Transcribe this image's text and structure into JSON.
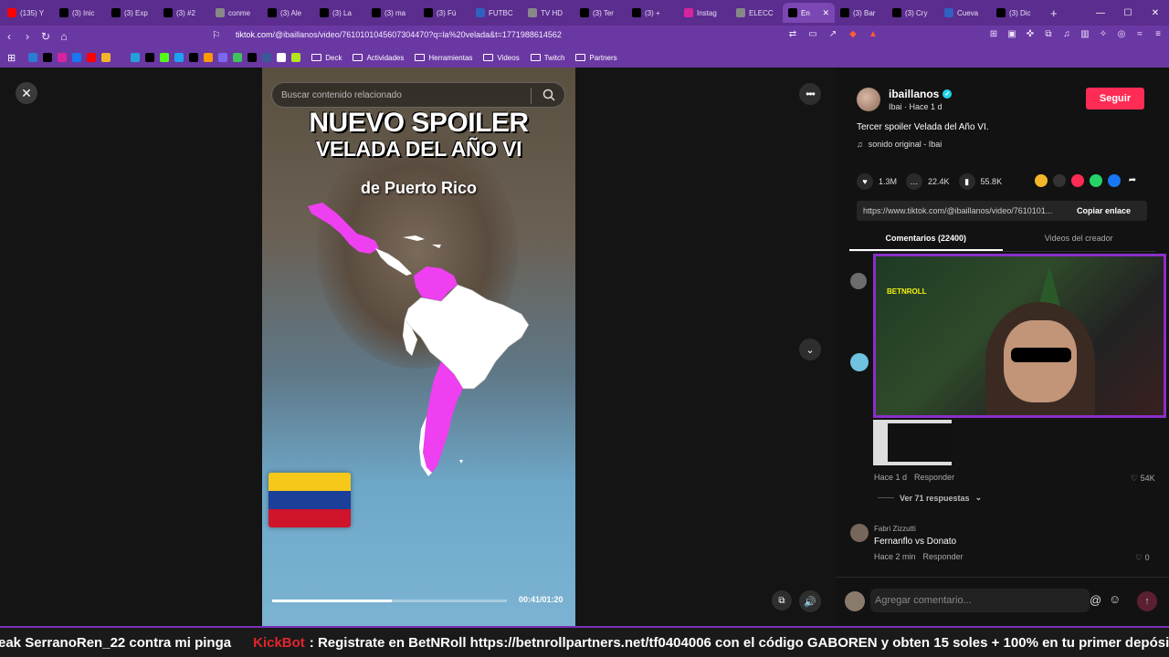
{
  "browser": {
    "tabs": [
      {
        "label": "(135) Y",
        "icon": "youtube-icon",
        "color": "#ff0000"
      },
      {
        "label": "(3) Inic",
        "icon": "x-icon",
        "color": "#000000"
      },
      {
        "label": "(3) Exp",
        "icon": "x-icon",
        "color": "#000000"
      },
      {
        "label": "(3) #2",
        "icon": "x-icon",
        "color": "#000000"
      },
      {
        "label": "conme",
        "icon": "web-icon",
        "color": "#888888"
      },
      {
        "label": "(3) Ale",
        "icon": "x-icon",
        "color": "#000000"
      },
      {
        "label": "(3) La",
        "icon": "x-icon",
        "color": "#000000"
      },
      {
        "label": "(3) ma",
        "icon": "x-icon",
        "color": "#000000"
      },
      {
        "label": "(3) Fú",
        "icon": "x-icon",
        "color": "#000000"
      },
      {
        "label": "FUTBC",
        "icon": "web-icon",
        "color": "#3060c0"
      },
      {
        "label": "TV HD",
        "icon": "web-icon",
        "color": "#888888"
      },
      {
        "label": "(3) Ter",
        "icon": "x-icon",
        "color": "#000000"
      },
      {
        "label": "(3) +",
        "icon": "x-icon",
        "color": "#000000"
      },
      {
        "label": "Instag",
        "icon": "instagram-icon",
        "color": "#d6249f"
      },
      {
        "label": "ELECC",
        "icon": "web-icon",
        "color": "#888888"
      },
      {
        "label": "En",
        "icon": "tiktok-icon",
        "color": "#000000",
        "active": true
      },
      {
        "label": "(3) Bar",
        "icon": "x-icon",
        "color": "#000000"
      },
      {
        "label": "(3) Cry",
        "icon": "x-icon",
        "color": "#000000"
      },
      {
        "label": "Cueva",
        "icon": "web-icon",
        "color": "#3060c0"
      },
      {
        "label": "(3) Dic",
        "icon": "x-icon",
        "color": "#000000"
      }
    ],
    "url_domain": "tiktok.com",
    "url_path": "/@ibaillanos/video/7610101045607304470?q=la%20velada&t=1771988614562",
    "bookmark_folders": [
      "Deck",
      "Actividades",
      "Herramientas",
      "Videos",
      "Twitch",
      "Partners"
    ]
  },
  "video": {
    "search_placeholder": "Buscar contenido relacionado",
    "title_line1": "NUEVO SPOILER",
    "title_line2": "VELADA DEL AÑO VI",
    "subtitle": "de Puerto Rico",
    "time": "00:41/01:20",
    "progress": 0.51,
    "highlight_color": "#ee3ff0"
  },
  "post": {
    "author": "ibaillanos",
    "meta": "Ibai · Hace 1 d",
    "follow_label": "Seguir",
    "description": "Tercer spoiler Velada del Año VI.",
    "sound": "sonido original - Ibai",
    "likes": "1.3M",
    "comments": "22.4K",
    "saves": "55.8K",
    "link": "https://www.tiktok.com/@ibaillanos/video/7610101...",
    "copy_label": "Copiar enlace",
    "tab_comments": "Comentarios (22400)",
    "tab_videos": "Videos del creador"
  },
  "comments": {
    "c1_time": "Hace 1 d",
    "c1_reply": "Responder",
    "c1_likes": "54K",
    "view_replies": "Ver 71 respuestas",
    "c2_name": "Fabri Zizzutti",
    "c2_text": "Fernanflo vs Donato",
    "c2_time": "Hace 2 min",
    "c2_reply": "Responder",
    "c2_likes": "0",
    "input_placeholder": "Agregar comentario..."
  },
  "webcam": {
    "label": "BETNROLL"
  },
  "ticker": {
    "prefix": "eak SerranoRen_22 contra mi pinga",
    "bot": "KickBot",
    "message": ": Registrate en BetNRoll https://betnrollpartners.net/tf0404006 con el código GABOREN y obten 15 soles + 100% en tu primer depósito"
  }
}
